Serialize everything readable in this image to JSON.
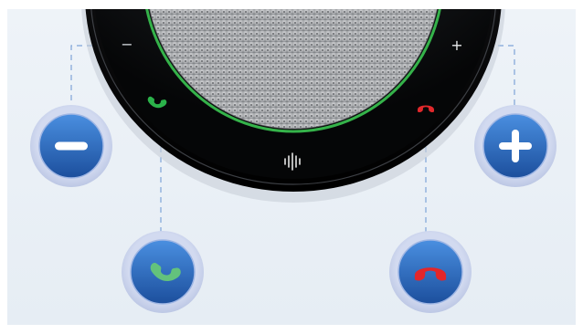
{
  "device": {
    "name": "speakerphone",
    "shown_labels": {
      "minus_symbol": "−",
      "plus_symbol": "+"
    },
    "status_ring_color": "#35b24a",
    "answer_icon_color": "#2bb24a",
    "end_icon_color": "#e0282b"
  },
  "callouts": [
    {
      "id": "volume-down",
      "icon": "minus-icon"
    },
    {
      "id": "answer-call",
      "icon": "phone-answer-icon"
    },
    {
      "id": "end-call",
      "icon": "phone-hangup-icon"
    },
    {
      "id": "volume-up",
      "icon": "plus-icon"
    }
  ],
  "colors": {
    "badge_outer": "#c7d0e9",
    "badge_inner_top": "#3d7fd6",
    "badge_inner_bottom": "#1b4f9f",
    "answer_green": "#63c27c",
    "end_red": "#e3262a",
    "leader_line": "#7ea4d8"
  }
}
